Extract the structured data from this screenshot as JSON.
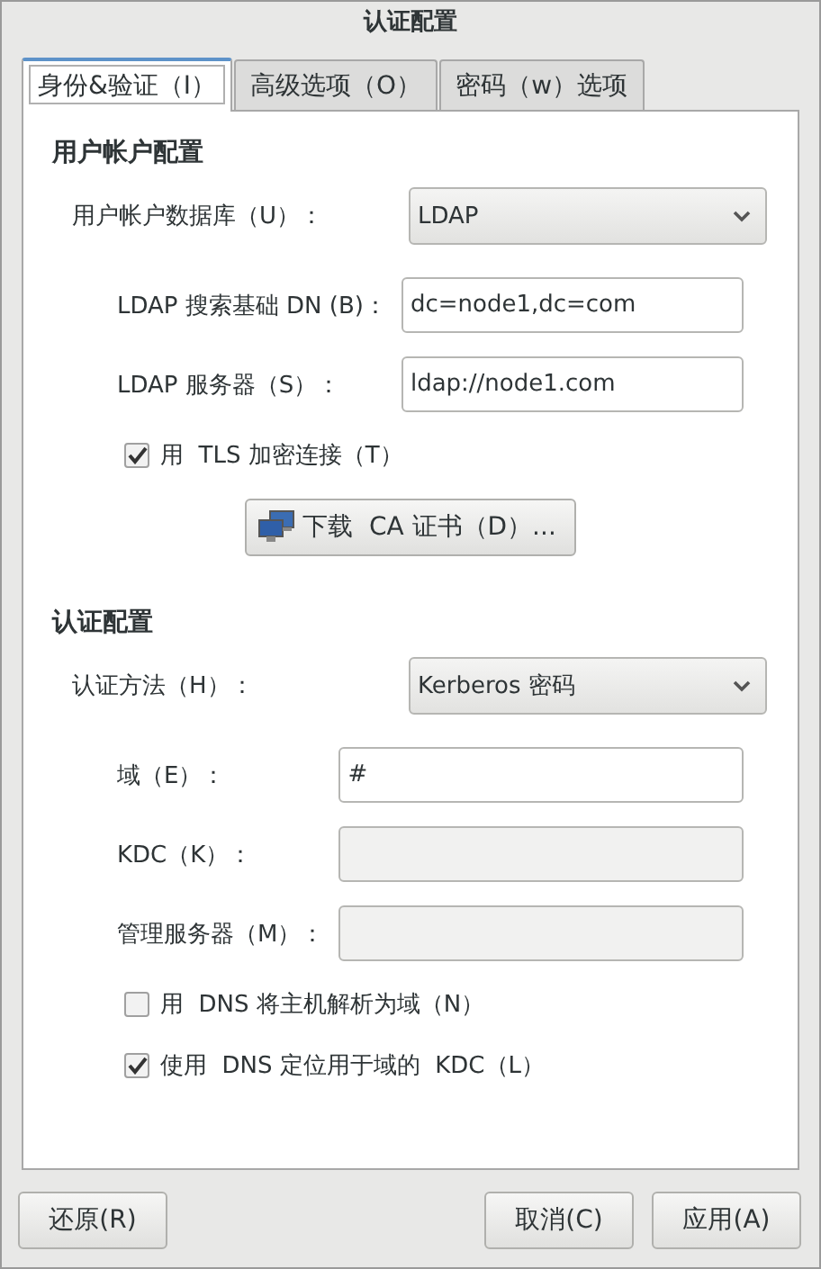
{
  "window": {
    "title": "认证配置"
  },
  "tabs": [
    {
      "label": "身份&验证（I）",
      "selected": true
    },
    {
      "label": "高级选项（O）",
      "selected": false
    },
    {
      "label": "密码（w）选项",
      "selected": false
    }
  ],
  "sections": [
    {
      "title": "用户帐户配置",
      "items": [
        {
          "kind": "dropdown",
          "label": "用户帐户数据库（U）：",
          "value": "LDAP"
        },
        {
          "kind": "field",
          "label": "LDAP 搜索基础 DN (B)：",
          "value": "dc=node1,dc=com",
          "disabled": false
        },
        {
          "kind": "field",
          "label": "LDAP 服务器（S）：",
          "value": "ldap://node1.com",
          "disabled": false
        },
        {
          "kind": "checkbox",
          "label": "用  TLS 加密连接（T）",
          "checked": true
        },
        {
          "kind": "button",
          "label": "下载  CA 证书（D）..."
        }
      ]
    },
    {
      "title": "认证配置",
      "items": [
        {
          "kind": "dropdown",
          "label": "认证方法（H）：",
          "value": "Kerberos 密码"
        },
        {
          "kind": "field",
          "label": "域（E）：",
          "value": "#",
          "disabled": false
        },
        {
          "kind": "field",
          "label": "KDC（K）：",
          "disabled": true
        },
        {
          "kind": "field",
          "label": "管理服务器（M）：",
          "disabled": true
        },
        {
          "kind": "checkbox",
          "label": "用  DNS 将主机解析为域（N）",
          "checked": false
        },
        {
          "kind": "checkbox",
          "label": "使用  DNS 定位用于域的  KDC（L）",
          "checked": true
        }
      ]
    }
  ],
  "buttons": {
    "left": [
      "还原(R)"
    ],
    "right": [
      "取消(C)",
      "应用(A)"
    ]
  }
}
